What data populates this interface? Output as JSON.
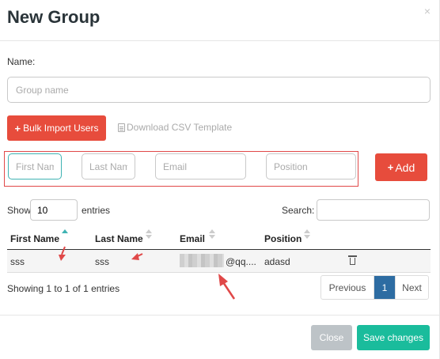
{
  "modal": {
    "title": "New Group",
    "close_glyph": "×"
  },
  "form": {
    "name_label": "Name:",
    "group_name_placeholder": "Group name",
    "bulk_import_label": "Bulk Import Users",
    "csv_template_label": "Download CSV Template"
  },
  "add_user": {
    "first_name_placeholder": "First Name",
    "last_name_placeholder": "Last Name",
    "email_placeholder": "Email",
    "position_placeholder": "Position",
    "add_label": "Add"
  },
  "table_controls": {
    "show_label": "Show",
    "entries_value": "10",
    "entries_label": "entries",
    "search_label": "Search:"
  },
  "table": {
    "columns": [
      "First Name",
      "Last Name",
      "Email",
      "Position"
    ],
    "rows": [
      {
        "first_name": "sss",
        "last_name": "sss",
        "email_suffix": "@qq....",
        "position": "adasd"
      }
    ]
  },
  "pagination": {
    "info": "Showing 1 to 1 of 1 entries",
    "previous": "Previous",
    "current_page": "1",
    "next": "Next"
  },
  "footer": {
    "close_label": "Close",
    "save_label": "Save changes"
  },
  "icons": {
    "plus": "+",
    "sort_active": "sort-asc-icon",
    "sort": "sort-icon",
    "trash": "trash-icon",
    "document": "document-icon"
  },
  "colors": {
    "danger": "#e74c3c",
    "success": "#1abc9c",
    "primary": "#2d6ca2",
    "muted_button": "#bdc3c7",
    "annotation": "#e04848"
  }
}
